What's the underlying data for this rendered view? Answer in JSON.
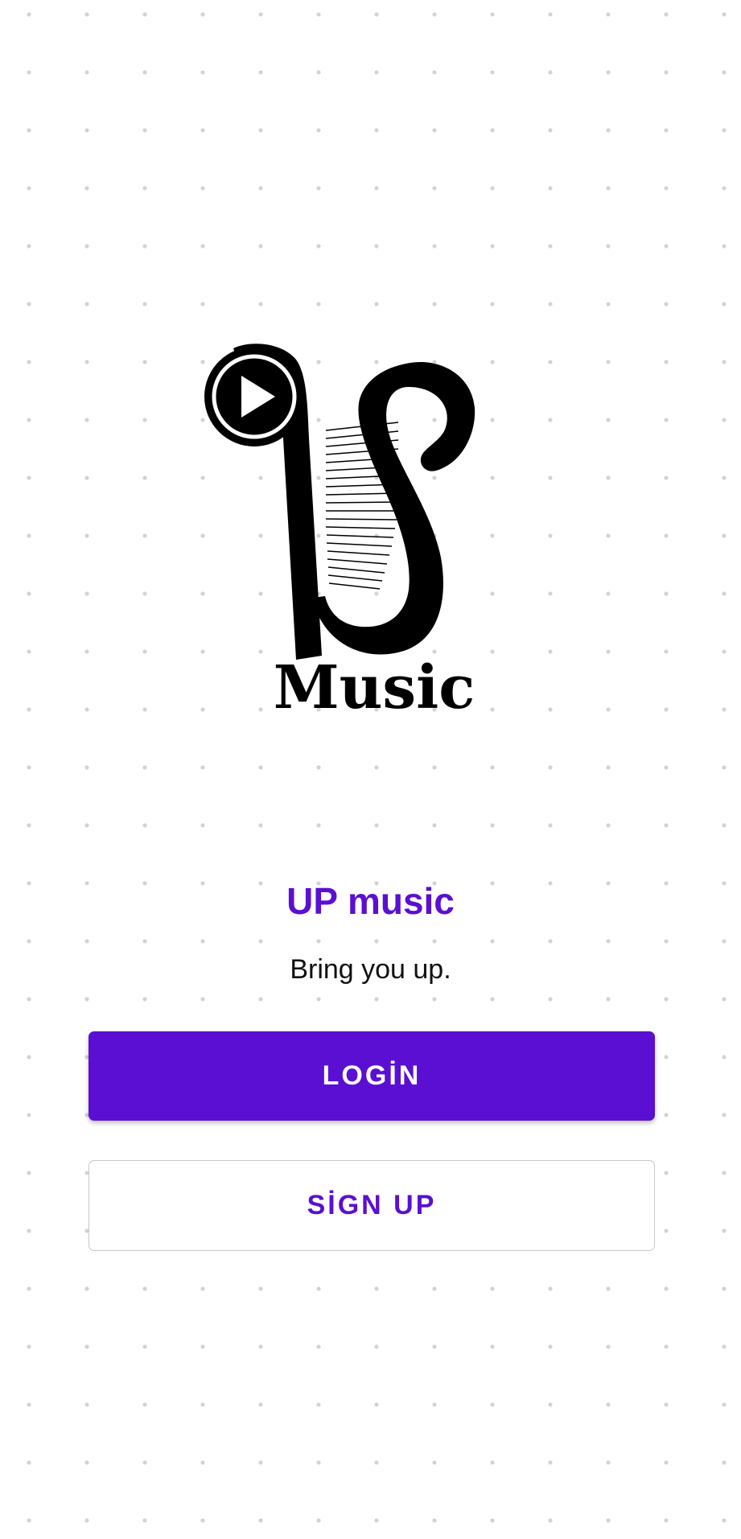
{
  "logo": {
    "icon": "up-music-harp-logo-icon",
    "wordmark": "Music"
  },
  "app": {
    "title": "UP music",
    "tagline": "Bring you up."
  },
  "buttons": {
    "login_label": "LOGİN",
    "signup_label": "SİGN UP"
  },
  "colors": {
    "accent": "#5a0fd3",
    "background": "#ffffff",
    "dot_grid": "#d3d3d3",
    "logo": "#000000"
  }
}
